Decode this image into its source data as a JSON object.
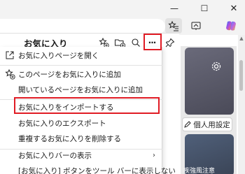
{
  "colors": {
    "highlight": "#e01b24",
    "menu_bg": "#ffffff",
    "chrome_bg": "#f3f3f3"
  },
  "window": {
    "controls": [
      {
        "name": "minimize",
        "glyph": "—"
      },
      {
        "name": "maximize",
        "glyph": "☐"
      },
      {
        "name": "close",
        "glyph": "✕"
      }
    ]
  },
  "toolbar": {
    "icons": [
      "favorites-icon",
      "screenshot-icon",
      "copilot-icon"
    ]
  },
  "favorites_panel": {
    "title": "お気に入り",
    "header_icons": [
      "add-favorite-icon",
      "add-folder-icon",
      "search-icon",
      "more-options-icon",
      "pin-icon"
    ],
    "more_glyph": "···"
  },
  "menu": {
    "items": [
      {
        "label": "お気に入りページを開く",
        "icon": "open-page-icon",
        "submenu": false
      },
      {
        "label": "このページをお気に入りに追加",
        "icon": "star-add-icon",
        "submenu": false
      },
      {
        "label": "開いているページをお気に入りに追加",
        "icon": "",
        "submenu": false
      },
      {
        "label": "お気に入りをインポートする",
        "icon": "",
        "submenu": false,
        "highlighted": true
      },
      {
        "label": "お気に入りのエクスポート",
        "icon": "",
        "submenu": false
      },
      {
        "label": "重複するお気に入りを削除する",
        "icon": "",
        "submenu": false
      },
      {
        "label": "お気に入りバーの表示",
        "icon": "",
        "submenu": true
      },
      {
        "label": "[お気に入り] ボタンをツール バーに表示しない",
        "icon": "",
        "submenu": false
      }
    ]
  },
  "background": {
    "personal_settings_label": "個人用設定",
    "dark_card_caption": "疾強風注意"
  }
}
